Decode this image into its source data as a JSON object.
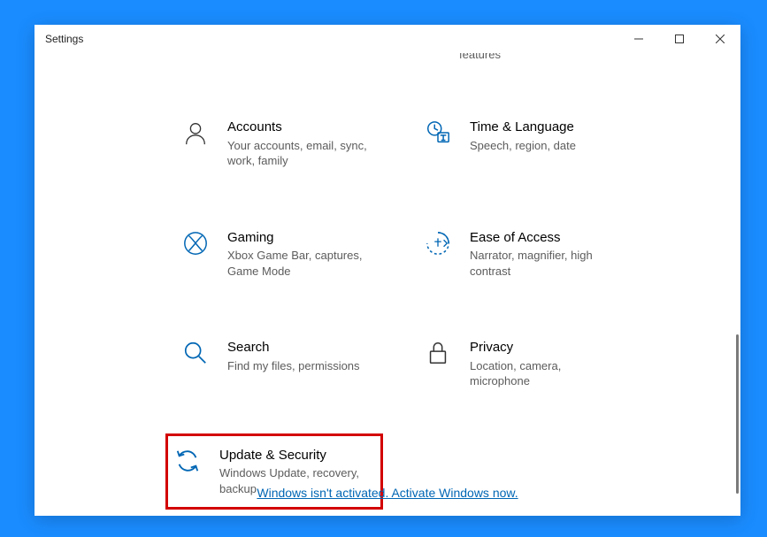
{
  "window": {
    "title": "Settings"
  },
  "partial": {
    "desc_fragment": "features"
  },
  "tiles": {
    "accounts": {
      "title": "Accounts",
      "desc": "Your accounts, email, sync, work, family"
    },
    "time_language": {
      "title": "Time & Language",
      "desc": "Speech, region, date"
    },
    "gaming": {
      "title": "Gaming",
      "desc": "Xbox Game Bar, captures, Game Mode"
    },
    "ease_of_access": {
      "title": "Ease of Access",
      "desc": "Narrator, magnifier, high contrast"
    },
    "search": {
      "title": "Search",
      "desc": "Find my files, permissions"
    },
    "privacy": {
      "title": "Privacy",
      "desc": "Location, camera, microphone"
    },
    "update_security": {
      "title": "Update & Security",
      "desc": "Windows Update, recovery, backup"
    }
  },
  "activation": {
    "text": "Windows isn't activated. Activate Windows now."
  }
}
